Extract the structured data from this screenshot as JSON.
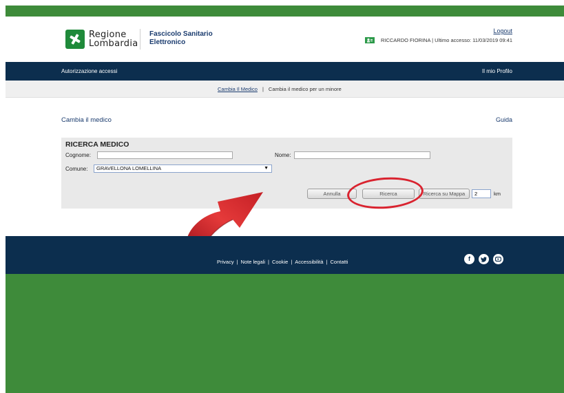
{
  "header": {
    "logo_line1": "Regione",
    "logo_line2": "Lombardia",
    "service_line1": "Fascicolo Sanitario",
    "service_line2": "Elettronico",
    "logout": "Logout",
    "user_info": "RICCARDO FIORINA | Ultimo accesso: 11/03/2019 09:41"
  },
  "nav": {
    "left": "Autorizzazione accessi",
    "right": "Il mio Profilo"
  },
  "subnav": {
    "item1": "Cambia Il Medico",
    "separator": "|",
    "item2": "Cambia il medico per un minore"
  },
  "content": {
    "title": "Cambia il medico",
    "help": "Guida"
  },
  "search": {
    "title": "RICERCA MEDICO",
    "surname_label": "Cognome:",
    "surname_value": "",
    "name_label": "Nome:",
    "name_value": "",
    "comune_label": "Comune:",
    "comune_value": "GRAVELLONA LOMELLINA",
    "cancel": "Annulla",
    "search": "Ricerca",
    "map_search": "Ricerca su Mappa",
    "km_value": "2",
    "km_unit": "km"
  },
  "footer": {
    "links": [
      "Privacy",
      "Note legali",
      "Cookie",
      "Accessibilità",
      "Contatti"
    ],
    "separator": "|",
    "social_icons": [
      "facebook-icon",
      "twitter-icon",
      "youtube-icon"
    ]
  },
  "colors": {
    "frame_green": "#3e8b3a",
    "navy": "#0c2e4e",
    "accent_red": "#d9232f",
    "link_blue": "#1a3b6e"
  }
}
